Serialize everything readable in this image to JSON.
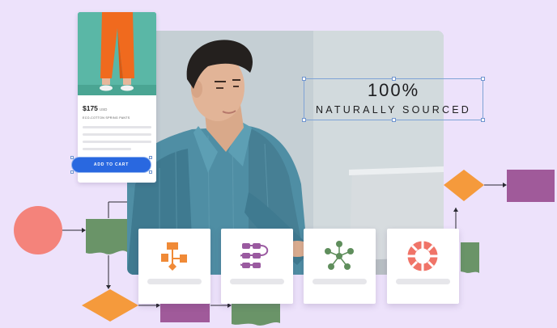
{
  "headline": {
    "big": "100%",
    "small": "NATURALLY SOURCED"
  },
  "product": {
    "price": "$175",
    "currency": "USD",
    "name": "ECO-COTTON SPRING PANTS",
    "add_to_cart": "ADD TO CART"
  },
  "icon_cards": [
    {
      "icon": "flowchart-icon",
      "color": "#f08a37"
    },
    {
      "icon": "process-steps-icon",
      "color": "#9a5aa0"
    },
    {
      "icon": "network-nodes-icon",
      "color": "#5f8e5c"
    },
    {
      "icon": "lifebuoy-icon",
      "color": "#f07468"
    }
  ],
  "colors": {
    "background": "#ede2fb",
    "accent_blue": "#2968e0",
    "coral": "#f4837b",
    "orange": "#f59a3c",
    "green": "#6a9468",
    "purple": "#a05a9a"
  }
}
